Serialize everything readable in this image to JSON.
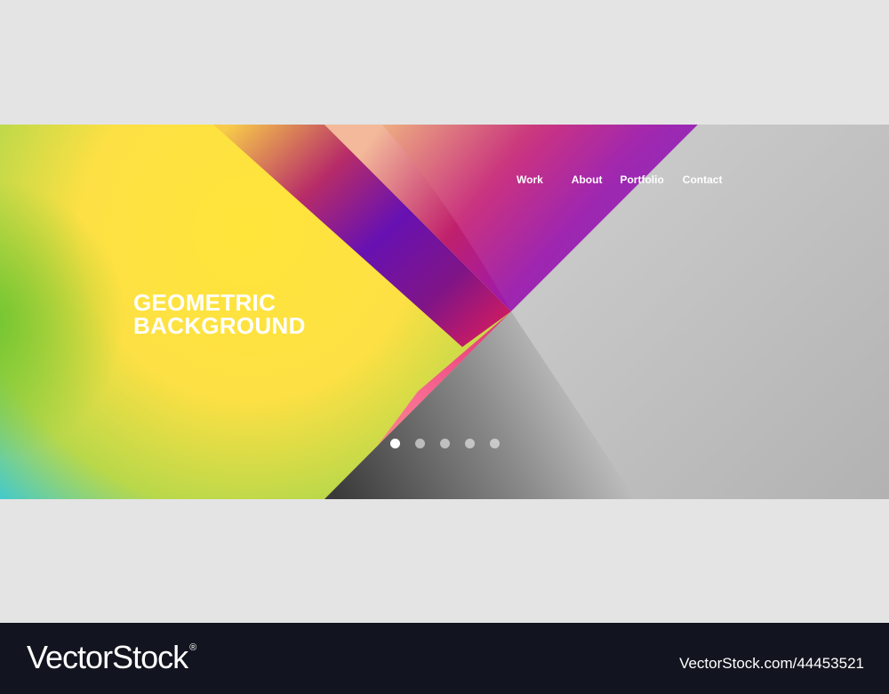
{
  "hero": {
    "headline_line1": "GEOMETRIC",
    "headline_line2": "BACKGROUND"
  },
  "nav": {
    "items": [
      {
        "label": "Work"
      },
      {
        "label": "About"
      },
      {
        "label": "Portfolio"
      },
      {
        "label": "Contact"
      }
    ]
  },
  "slider": {
    "dot_count": 5,
    "active_index": 0
  },
  "footer": {
    "logo_text": "VectorStock",
    "logo_mark": "®",
    "image_id": "VectorStock.com/44453521"
  },
  "colors": {
    "yellow": "#fde23a",
    "purple": "#5a00c8",
    "magenta": "#e81a7a",
    "gray": "#bdbdbd",
    "footer_bg": "#12151f"
  }
}
